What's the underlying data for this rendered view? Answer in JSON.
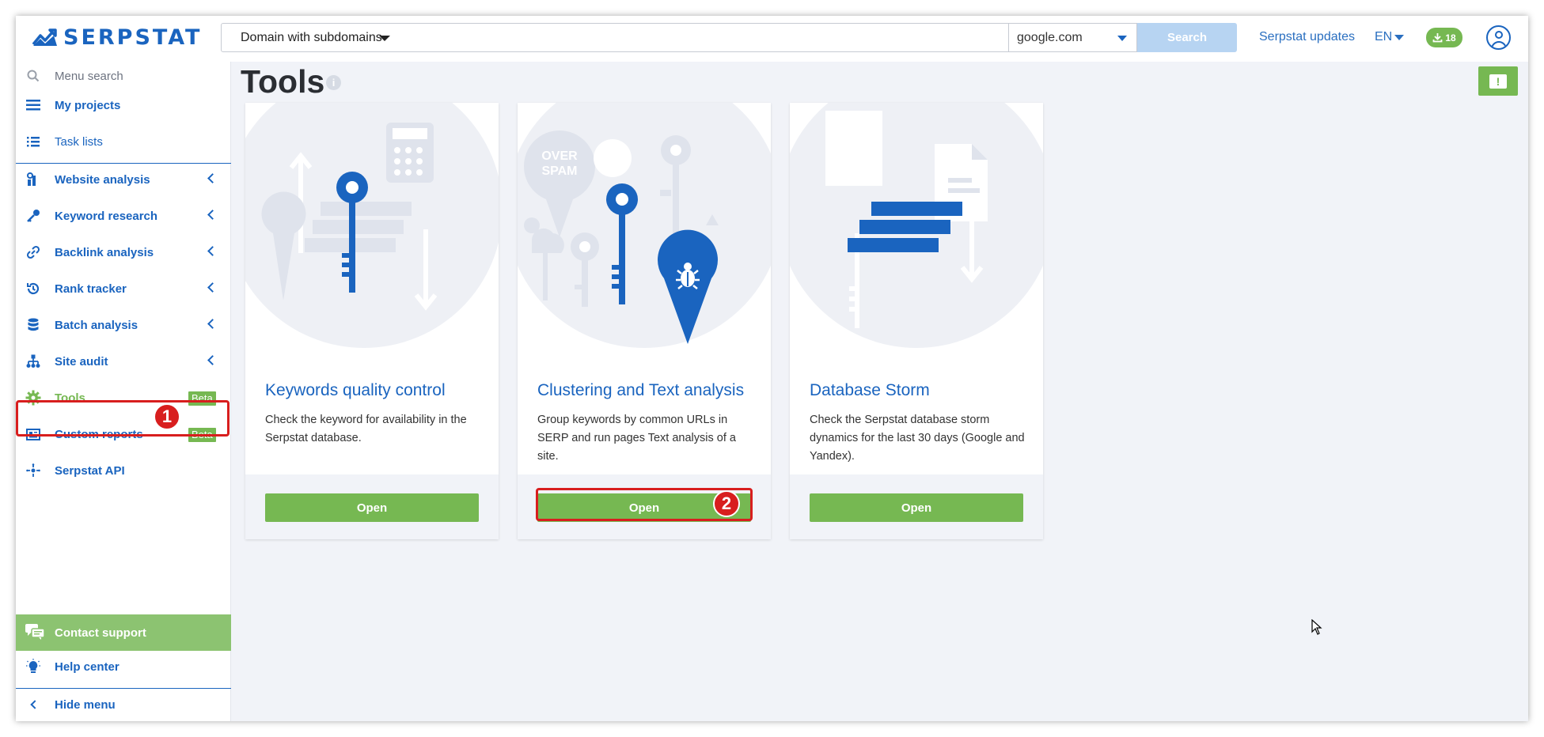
{
  "header": {
    "brand": "SERPSTAT",
    "domain_mode": "Domain with subdomains",
    "search_value": "",
    "engine": "google.com",
    "search_label": "Search",
    "updates_label": "Serpstat updates",
    "language": "EN",
    "downloads_count": "18"
  },
  "sidebar": {
    "menu_search_placeholder": "Menu search",
    "items": [
      {
        "label": "My projects"
      },
      {
        "label": "Task lists"
      },
      {
        "label": "Website analysis"
      },
      {
        "label": "Keyword research"
      },
      {
        "label": "Backlink analysis"
      },
      {
        "label": "Rank tracker"
      },
      {
        "label": "Batch analysis"
      },
      {
        "label": "Site audit"
      },
      {
        "label": "Tools",
        "badge": "Beta",
        "active": true
      },
      {
        "label": "Custom reports",
        "badge": "Beta"
      },
      {
        "label": "Serpstat API"
      }
    ],
    "contact_label": "Contact support",
    "help_label": "Help center",
    "hide_label": "Hide menu"
  },
  "main": {
    "title": "Tools",
    "cards": [
      {
        "title": "Keywords quality control",
        "description": "Check the keyword for availability in the Serpstat database.",
        "button": "Open"
      },
      {
        "title": "Clustering and Text analysis",
        "description": "Group keywords by common URLs in SERP and run pages Text analysis of a site.",
        "button": "Open",
        "illustration_text": "OVER SPAM"
      },
      {
        "title": "Database Storm",
        "description": "Check the Serpstat database storm dynamics for the last 30 days (Google and Yandex).",
        "button": "Open"
      }
    ]
  },
  "annotations": {
    "step1": "1",
    "step2": "2",
    "highlight_color": "#d81e1e"
  },
  "colors": {
    "brand_blue": "#1a64bf",
    "accent_green": "#76b852",
    "search_button": "#b7d4f2",
    "background": "#f1f3f8"
  }
}
